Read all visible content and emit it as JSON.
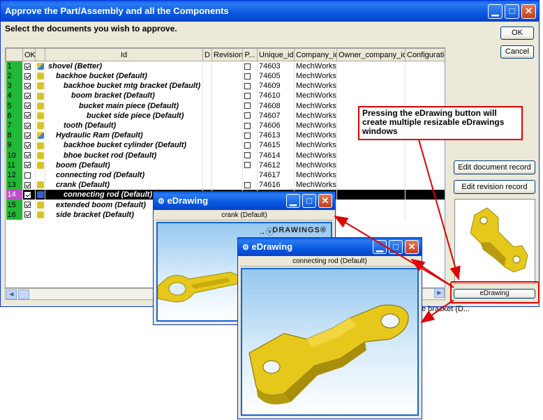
{
  "window": {
    "title": "Approve the Part/Assembly and all the Components",
    "instruction": "Select the documents you wish to approve."
  },
  "table": {
    "columns": [
      "OK",
      "Id",
      "D",
      "Revision",
      "P...",
      "Unique_id",
      "Company_id",
      "Owner_company_id",
      "Configuration"
    ],
    "rows": [
      {
        "num": "1",
        "ok": true,
        "icon": "assembly",
        "name": "shovel (Better)",
        "indent": 0,
        "p": false,
        "unique_id": "74603",
        "company_id": "MechWorks"
      },
      {
        "num": "2",
        "ok": true,
        "icon": "part",
        "name": "backhoe bucket (Default)",
        "indent": 1,
        "p": false,
        "unique_id": "74605",
        "company_id": "MechWorks"
      },
      {
        "num": "3",
        "ok": true,
        "icon": "part",
        "name": "backhoe bucket mtg bracket (Default)",
        "indent": 2,
        "p": false,
        "unique_id": "74609",
        "company_id": "MechWorks"
      },
      {
        "num": "4",
        "ok": true,
        "icon": "part",
        "name": "boom bracket (Default)",
        "indent": 3,
        "p": false,
        "unique_id": "74610",
        "company_id": "MechWorks"
      },
      {
        "num": "5",
        "ok": true,
        "icon": "part",
        "name": "bucket main piece (Default)",
        "indent": 4,
        "p": false,
        "unique_id": "74608",
        "company_id": "MechWorks"
      },
      {
        "num": "6",
        "ok": true,
        "icon": "part",
        "name": "bucket side piece (Default)",
        "indent": 5,
        "p": false,
        "unique_id": "74607",
        "company_id": "MechWorks"
      },
      {
        "num": "7",
        "ok": true,
        "icon": "part",
        "name": "tooth (Default)",
        "indent": 2,
        "p": false,
        "unique_id": "74606",
        "company_id": "MechWorks"
      },
      {
        "num": "8",
        "ok": true,
        "icon": "assembly",
        "name": "Hydraulic Ram (Default)",
        "indent": 1,
        "p": false,
        "unique_id": "74613",
        "company_id": "MechWorks"
      },
      {
        "num": "9",
        "ok": true,
        "icon": "part",
        "name": "backhoe bucket cylinder (Default)",
        "indent": 2,
        "p": false,
        "unique_id": "74615",
        "company_id": "MechWorks"
      },
      {
        "num": "10",
        "ok": true,
        "icon": "part",
        "name": "bhoe bucket rod (Default)",
        "indent": 2,
        "p": false,
        "unique_id": "74614",
        "company_id": "MechWorks"
      },
      {
        "num": "11",
        "ok": true,
        "icon": "part",
        "name": "boom (Default)",
        "indent": 1,
        "p": false,
        "unique_id": "74612",
        "company_id": "MechWorks"
      },
      {
        "num": "12",
        "ok": false,
        "icon": "none",
        "name": "connecting rod (Default)",
        "indent": 1,
        "p": null,
        "unique_id": "74617",
        "company_id": "MechWorks"
      },
      {
        "num": "13",
        "ok": true,
        "icon": "part",
        "name": "crank (Default)",
        "indent": 1,
        "p": false,
        "unique_id": "74616",
        "company_id": "MechWorks"
      },
      {
        "num": "14",
        "ok": true,
        "icon": "selected",
        "name": "connecting rod (Default)",
        "indent": 2,
        "p": null,
        "unique_id": "",
        "company_id": "",
        "selected": true
      },
      {
        "num": "15",
        "ok": true,
        "icon": "part",
        "name": "extended boom (Default)",
        "indent": 1,
        "p": null,
        "unique_id": "",
        "company_id": ""
      },
      {
        "num": "16",
        "ok": true,
        "icon": "part",
        "name": "side bracket (Default)",
        "indent": 1,
        "p": null,
        "unique_id": "",
        "company_id": ""
      }
    ]
  },
  "buttons": {
    "ok": "OK",
    "cancel": "Cancel",
    "edit_document": "Edit document record",
    "edit_revision": "Edit revision record",
    "edrawing": "eDrawing"
  },
  "callout": {
    "text": "Pressing the eDrawing button will create multiple resizable eDrawings windows"
  },
  "partial_text": "e bracket (D...",
  "edrawing_windows": [
    {
      "title": "eDrawing",
      "subtitle": "crank (Default)",
      "logo": "DRAWINGS®"
    },
    {
      "title": "eDrawing",
      "subtitle": "connecting rod (Default)"
    }
  ],
  "colors": {
    "titlebar": "#0857e0",
    "row_number": "#22b935",
    "selected_row_number": "#c04ecb",
    "callout_border": "#e00000",
    "part_yellow": "#e6c81c"
  }
}
